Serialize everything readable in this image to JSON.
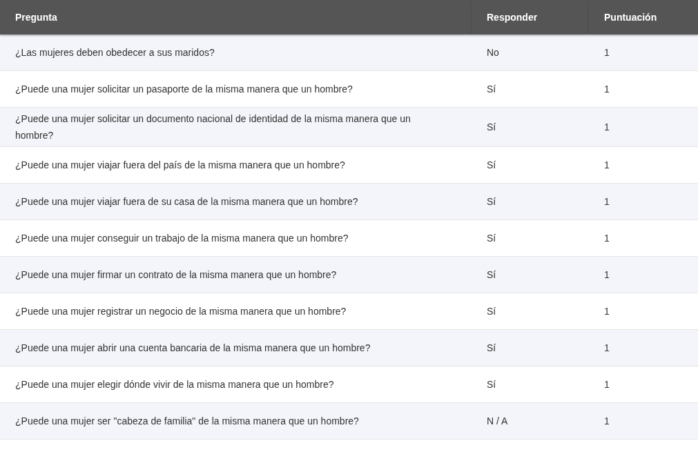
{
  "table": {
    "columns": [
      "Pregunta",
      "Responder",
      "Puntuación"
    ],
    "rows": [
      {
        "question": "¿Las mujeres deben obedecer a sus maridos?",
        "answer": "No",
        "score": "1"
      },
      {
        "question": "¿Puede una mujer solicitar un pasaporte de la misma manera que un hombre?",
        "answer": "Sí",
        "score": "1"
      },
      {
        "question": "¿Puede una mujer solicitar un documento nacional de identidad de la misma manera que un hombre?",
        "answer": "Sí",
        "score": "1"
      },
      {
        "question": "¿Puede una mujer viajar fuera del país de la misma manera que un hombre?",
        "answer": "Sí",
        "score": "1"
      },
      {
        "question": "¿Puede una mujer viajar fuera de su casa de la misma manera que un hombre?",
        "answer": "Sí",
        "score": "1"
      },
      {
        "question": "¿Puede una mujer conseguir un trabajo de la misma manera que un hombre?",
        "answer": "Sí",
        "score": "1"
      },
      {
        "question": "¿Puede una mujer firmar un contrato de la misma manera que un hombre?",
        "answer": "Sí",
        "score": "1"
      },
      {
        "question": "¿Puede una mujer registrar un negocio de la misma manera que un hombre?",
        "answer": "Sí",
        "score": "1"
      },
      {
        "question": "¿Puede una mujer abrir una cuenta bancaria de la misma manera que un hombre?",
        "answer": "Sí",
        "score": "1"
      },
      {
        "question": "¿Puede una mujer elegir dónde vivir de la misma manera que un hombre?",
        "answer": "Sí",
        "score": "1"
      },
      {
        "question": "¿Puede una mujer ser \"cabeza de familia\" de la misma manera que un hombre?",
        "answer": "N / A",
        "score": "1"
      }
    ]
  }
}
